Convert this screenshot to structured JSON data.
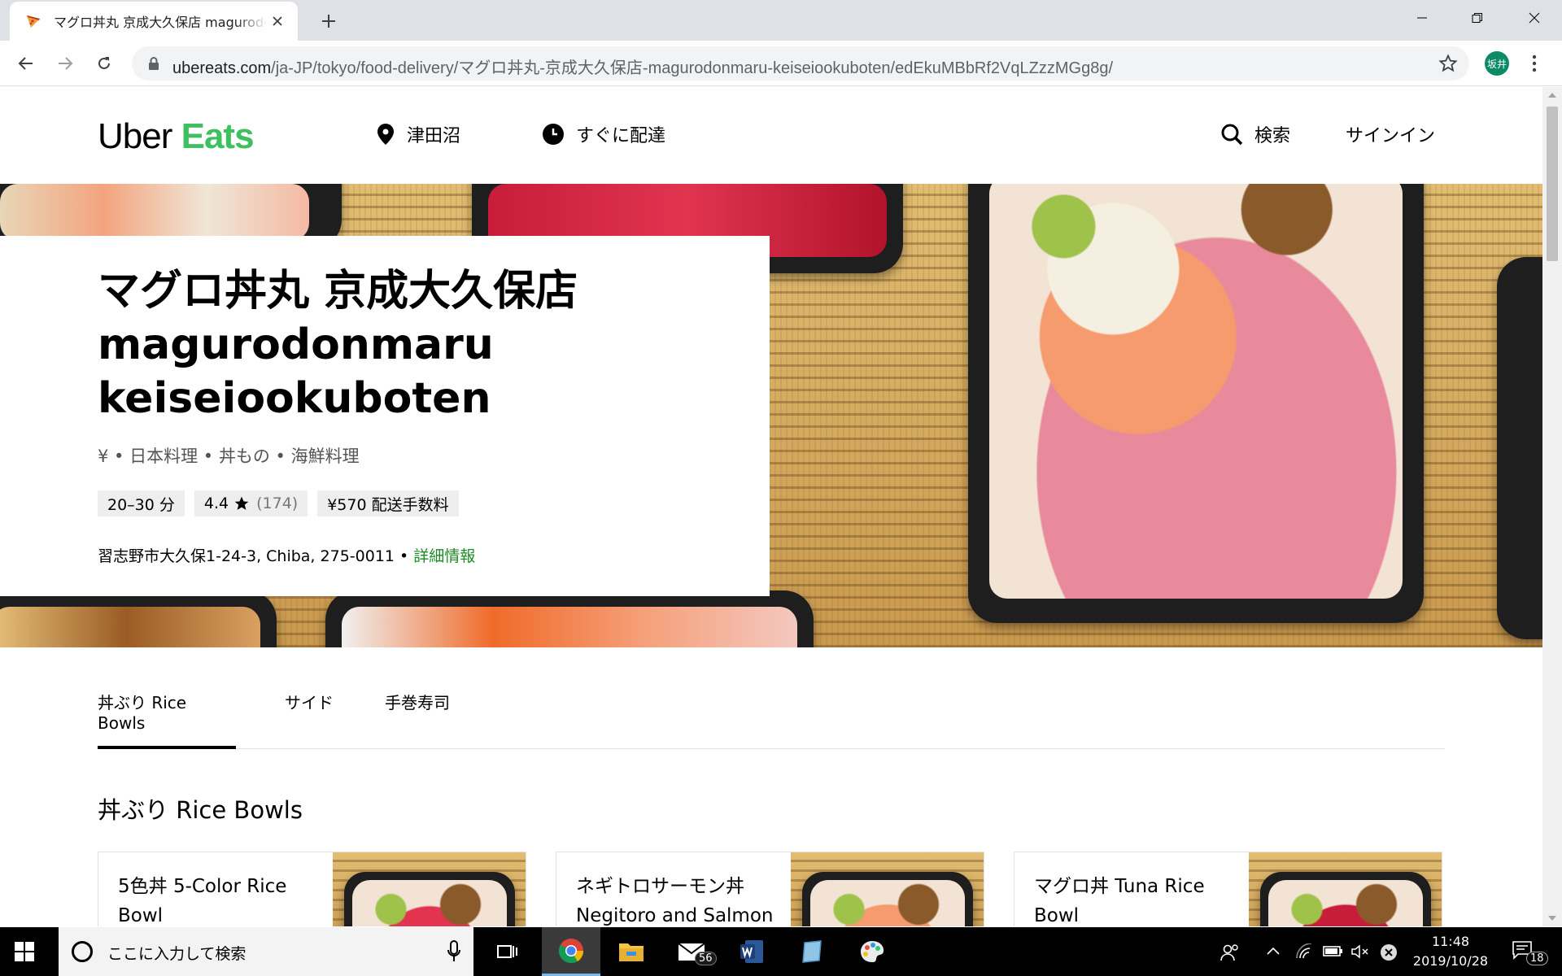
{
  "browser": {
    "tab_title": "マグロ丼丸 京成大久保店 magurodonmaru keiseiookuboten",
    "url_host": "ubereats.com",
    "url_path": "/ja-JP/tokyo/food-delivery/マグロ丼丸-京成大久保店-magurodonmaru-keiseiookuboten/edEkuMBbRf2VqLZzzMGg8g/",
    "profile_initials": "坂井"
  },
  "header": {
    "logo_uber": "Uber",
    "logo_eats": "Eats",
    "location": "津田沼",
    "delivery_time": "すぐに配達",
    "search": "検索",
    "signin": "サインイン"
  },
  "store": {
    "title_line1": "マグロ丼丸 京成大久保店",
    "title_line2": "magurodonmaru",
    "title_line3": "keiseiookuboten",
    "cuisine": "¥ • 日本料理 • 丼もの • 海鮮料理",
    "eta": "20–30 分",
    "rating": "4.4",
    "rating_count": "(174)",
    "delivery_fee": "¥570 配送手数料",
    "address": "習志野市大久保1-24-3, Chiba, 275-0011 • ",
    "details_link": "詳細情報"
  },
  "menu_tabs": [
    {
      "label": "丼ぶり Rice Bowls",
      "active": true
    },
    {
      "label": "サイド",
      "active": false
    },
    {
      "label": "手巻寿司",
      "active": false
    }
  ],
  "section": {
    "title": "丼ぶり Rice Bowls"
  },
  "menu_items": [
    {
      "name": "5色丼 5-Color Rice Bowl"
    },
    {
      "name": "ネギトロサーモン丼 Negitoro and Salmon"
    },
    {
      "name": "マグロ丼 Tuna Rice Bowl"
    }
  ],
  "taskbar": {
    "search_placeholder": "ここに入力して検索",
    "mail_badge": "56",
    "time": "11:48",
    "date": "2019/10/28",
    "notification_count": "18"
  },
  "colors": {
    "brand_green": "#3fc060",
    "link_green": "#1f8b24",
    "tab_strip": "#dee1e6",
    "profile": "#0b8a67"
  }
}
